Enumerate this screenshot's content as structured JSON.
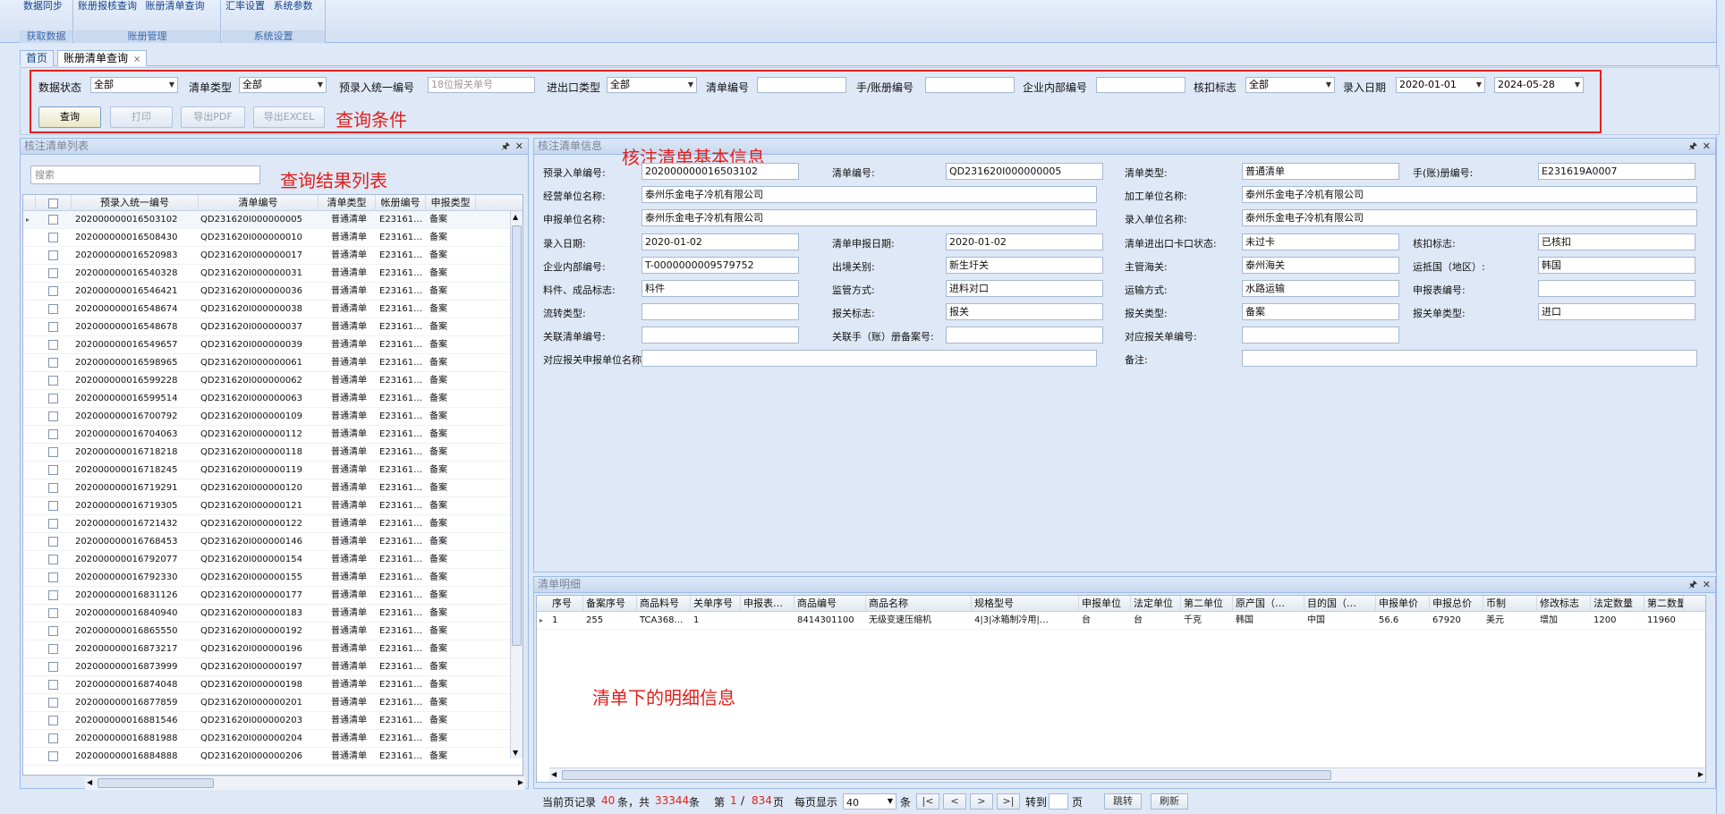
{
  "ribbon": {
    "groups": [
      {
        "buttons": [
          "数据同步"
        ],
        "label": "获取数据"
      },
      {
        "buttons": [
          "账册报核查询",
          "账册清单查询"
        ],
        "label": "账册管理"
      },
      {
        "buttons": [
          "汇率设置",
          "系统参数"
        ],
        "label": "系统设置"
      }
    ]
  },
  "tabs": [
    {
      "label": "首页"
    },
    {
      "label": "账册清单查询",
      "close": "×"
    }
  ],
  "query": {
    "fields": {
      "data_status_label": "数据状态",
      "data_status": "全部",
      "list_type_label": "清单类型",
      "list_type": "全部",
      "pre_no_label": "预录入统一编号",
      "pre_no_placeholder": "18位报关单号",
      "ie_type_label": "进出口类型",
      "ie_type": "全部",
      "list_no_label": "清单编号",
      "list_no": "",
      "book_no_label": "手/账册编号",
      "book_no": "",
      "internal_no_label": "企业内部编号",
      "internal_no": "",
      "verify_flag_label": "核扣标志",
      "verify_flag": "全部",
      "entry_date_label": "录入日期",
      "date_from": "2020-01-01",
      "date_to": "2024-05-28"
    },
    "buttons": {
      "search": "查询",
      "print": "打印",
      "export_pdf": "导出PDF",
      "export_excel": "导出EXCEL"
    },
    "note": "查询条件"
  },
  "list_panel": {
    "title": "核注清单列表",
    "search_placeholder": "搜索",
    "note": "查询结果列表",
    "columns": [
      "预录入统一编号",
      "清单编号",
      "清单类型",
      "帐册编号",
      "申报类型"
    ],
    "rows": [
      [
        "202000000016503102",
        "QD231620I000000005",
        "普通清单",
        "E23161…",
        "备案"
      ],
      [
        "202000000016508430",
        "QD231620I000000010",
        "普通清单",
        "E23161…",
        "备案"
      ],
      [
        "202000000016520983",
        "QD231620I000000017",
        "普通清单",
        "E23161…",
        "备案"
      ],
      [
        "202000000016540328",
        "QD231620I000000031",
        "普通清单",
        "E23161…",
        "备案"
      ],
      [
        "202000000016546421",
        "QD231620I000000036",
        "普通清单",
        "E23161…",
        "备案"
      ],
      [
        "202000000016548674",
        "QD231620I000000038",
        "普通清单",
        "E23161…",
        "备案"
      ],
      [
        "202000000016548678",
        "QD231620I000000037",
        "普通清单",
        "E23161…",
        "备案"
      ],
      [
        "202000000016549657",
        "QD231620I000000039",
        "普通清单",
        "E23161…",
        "备案"
      ],
      [
        "202000000016598965",
        "QD231620I000000061",
        "普通清单",
        "E23161…",
        "备案"
      ],
      [
        "202000000016599228",
        "QD231620I000000062",
        "普通清单",
        "E23161…",
        "备案"
      ],
      [
        "202000000016599514",
        "QD231620I000000063",
        "普通清单",
        "E23161…",
        "备案"
      ],
      [
        "202000000016700792",
        "QD231620I000000109",
        "普通清单",
        "E23161…",
        "备案"
      ],
      [
        "202000000016704063",
        "QD231620I000000112",
        "普通清单",
        "E23161…",
        "备案"
      ],
      [
        "202000000016718218",
        "QD231620I000000118",
        "普通清单",
        "E23161…",
        "备案"
      ],
      [
        "202000000016718245",
        "QD231620I000000119",
        "普通清单",
        "E23161…",
        "备案"
      ],
      [
        "202000000016719291",
        "QD231620I000000120",
        "普通清单",
        "E23161…",
        "备案"
      ],
      [
        "202000000016719305",
        "QD231620I000000121",
        "普通清单",
        "E23161…",
        "备案"
      ],
      [
        "202000000016721432",
        "QD231620I000000122",
        "普通清单",
        "E23161…",
        "备案"
      ],
      [
        "202000000016768453",
        "QD231620I000000146",
        "普通清单",
        "E23161…",
        "备案"
      ],
      [
        "202000000016792077",
        "QD231620I000000154",
        "普通清单",
        "E23161…",
        "备案"
      ],
      [
        "202000000016792330",
        "QD231620I000000155",
        "普通清单",
        "E23161…",
        "备案"
      ],
      [
        "202000000016831126",
        "QD231620I000000177",
        "普通清单",
        "E23161…",
        "备案"
      ],
      [
        "202000000016840940",
        "QD231620I000000183",
        "普通清单",
        "E23161…",
        "备案"
      ],
      [
        "202000000016865550",
        "QD231620I000000192",
        "普通清单",
        "E23161…",
        "备案"
      ],
      [
        "202000000016873217",
        "QD231620I000000196",
        "普通清单",
        "E23161…",
        "备案"
      ],
      [
        "202000000016873999",
        "QD231620I000000197",
        "普通清单",
        "E23161…",
        "备案"
      ],
      [
        "202000000016874048",
        "QD231620I000000198",
        "普通清单",
        "E23161…",
        "备案"
      ],
      [
        "202000000016877859",
        "QD231620I000000201",
        "普通清单",
        "E23161…",
        "备案"
      ],
      [
        "202000000016881546",
        "QD231620I000000203",
        "普通清单",
        "E23161…",
        "备案"
      ],
      [
        "202000000016881988",
        "QD231620I000000204",
        "普通清单",
        "E23161…",
        "备案"
      ],
      [
        "202000000016884888",
        "QD231620I000000206",
        "普通清单",
        "E23161…",
        "备案"
      ]
    ]
  },
  "info_panel": {
    "title": "核注清单信息",
    "note": "核注清单基本信息",
    "fields": {
      "pre_no_label": "预录入单编号:",
      "pre_no": "202000000016503102",
      "list_no_label": "清单编号:",
      "list_no": "QD231620I000000005",
      "list_type_label": "清单类型:",
      "list_type": "普通清单",
      "book_no_label": "手(账)册编号:",
      "book_no": "E231619A0007",
      "op_unit_label": "经营单位名称:",
      "op_unit": "泰州乐金电子冷机有限公司",
      "proc_unit_label": "加工单位名称:",
      "proc_unit": "泰州乐金电子冷机有限公司",
      "decl_unit_label": "申报单位名称:",
      "decl_unit": "泰州乐金电子冷机有限公司",
      "entry_unit_label": "录入单位名称:",
      "entry_unit": "泰州乐金电子冷机有限公司",
      "entry_date_label": "录入日期:",
      "entry_date": "2020-01-02",
      "decl_date_label": "清单申报日期:",
      "decl_date": "2020-01-02",
      "gate_status_label": "清单进出口卡口状态:",
      "gate_status": "未过卡",
      "verify_flag_label": "核扣标志:",
      "verify_flag": "已核扣",
      "internal_no_label": "企业内部编号:",
      "internal_no": "T-0000000009579752",
      "port_label": "出境关别:",
      "port": "新生圩关",
      "customs_label": "主管海关:",
      "customs": "泰州海关",
      "country_label": "运抵国（地区）:",
      "country": "韩国",
      "material_label": "料件、成品标志:",
      "material": "料件",
      "supervise_label": "监管方式:",
      "supervise": "进料对口",
      "transport_label": "运输方式:",
      "transport": "水路运输",
      "decl_form_label": "申报表编号:",
      "decl_form": "",
      "transfer_label": "流转类型:",
      "transfer": "",
      "customs_flag_label": "报关标志:",
      "customs_flag": "报关",
      "customs_type_label": "报关类型:",
      "customs_type": "备案",
      "customs_form_label": "报关单类型:",
      "customs_form": "进口",
      "rel_list_label": "关联清单编号:",
      "rel_list": "",
      "rel_book_label": "关联手（账）册备案号:",
      "rel_book": "",
      "rel_decl_label": "对应报关单编号:",
      "rel_decl": "",
      "rel_decl_unit_label": "对应报关申报单位名称:",
      "rel_decl_unit": "",
      "remark_label": "备注:",
      "remark": ""
    }
  },
  "detail_panel": {
    "title": "清单明细",
    "note": "清单下的明细信息",
    "columns": [
      "序号",
      "备案序号",
      "商品料号",
      "关单序号",
      "申报表…",
      "商品编号",
      "商品名称",
      "规格型号",
      "申报单位",
      "法定单位",
      "第二单位",
      "原产国（…",
      "目的国（…",
      "申报单价",
      "申报总价",
      "币制",
      "修改标志",
      "法定数量",
      "第二数量"
    ],
    "rows": [
      [
        "1",
        "255",
        "TCA368…",
        "1",
        "",
        "8414301100",
        "无级变速压缩机",
        "4|3|冰箱制冷用|…",
        "台",
        "台",
        "千克",
        "韩国",
        "中国",
        "56.6",
        "67920",
        "美元",
        "增加",
        "1200",
        "11960"
      ]
    ]
  },
  "pager": {
    "current_label": "当前页记录",
    "current_count": "40",
    "unit1": "条，共",
    "total": "33344",
    "unit2": "条",
    "page_label": "第",
    "page": "1",
    "slash": "/",
    "pages": "834",
    "page_unit": "页",
    "per_page_label": "每页显示",
    "per_page": "40",
    "per_unit": "条",
    "first": "|<",
    "prev": "<",
    "next": ">",
    "last": ">|",
    "goto_label": "转到",
    "goto_value": "",
    "goto_unit": "页",
    "jump": "跳转",
    "refresh": "刷新"
  },
  "colors": {
    "accent": "#15428b",
    "annotation": "#e2201c",
    "panel_bg": "#dfe8f6",
    "border": "#99bbe8"
  }
}
